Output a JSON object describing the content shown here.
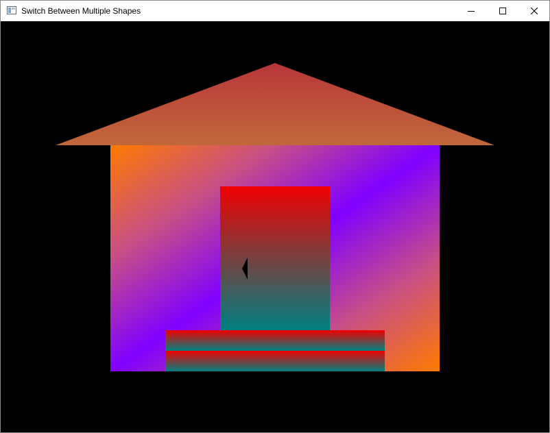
{
  "window": {
    "title": "Switch Between Multiple Shapes",
    "controls": {
      "minimize_icon": "minimize-icon",
      "maximize_icon": "maximize-icon",
      "close_icon": "close-icon"
    }
  },
  "scene": {
    "background": "#000000",
    "roof": {
      "top_color": "#b8363a",
      "bottom_color": "#c0683a"
    },
    "wall": {
      "corner_color": "#ff7a00",
      "center_color": "#8000ff",
      "mid_color": "#c74f86"
    },
    "door": {
      "top_color": "#f00000",
      "bottom_color": "#008080"
    },
    "steps": {
      "top_color": "#f00000",
      "bottom_color": "#008080",
      "count": 2
    },
    "handle_color": "#000000"
  }
}
